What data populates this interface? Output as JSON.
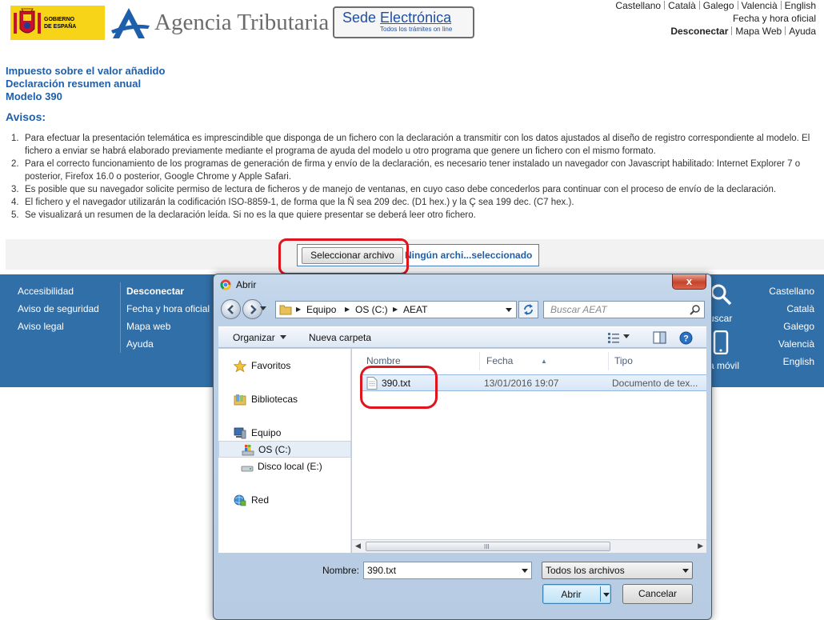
{
  "header": {
    "gov_logo_text": [
      "GOBIERNO",
      "DE ESPAÑA"
    ],
    "agency_name": "Agencia Tributaria",
    "sede_title_a": "Sede ",
    "sede_title_b": "Electrónica",
    "sede_subtitle": "Todos los trámites on line",
    "languages": [
      "Castellano",
      "Català",
      "Galego",
      "Valencià",
      "English"
    ],
    "time_link": "Fecha y hora oficial",
    "logout": "Desconectar",
    "sitemap": "Mapa Web",
    "help": "Ayuda"
  },
  "page": {
    "title_lines": [
      "Impuesto sobre el valor añadido",
      "Declaración resumen anual",
      "Modelo 390"
    ],
    "avisos_heading": "Avisos:",
    "notices": [
      "Para efectuar la presentación telemática es imprescindible que disponga de un fichero con la declaración a transmitir con los datos ajustados al diseño de registro correspondiente al modelo. El fichero a enviar se habrá elaborado previamente mediante el programa de ayuda del modelo u otro programa que genere un fichero con el mismo formato.",
      "Para el correcto funcionamiento de los programas de generación de firma y envío de la declaración, es necesario tener instalado un navegador con Javascript habilitado: Internet Explorer 7 o posterior, Firefox 16.0 o posterior, Google Chrome y Apple Safari.",
      "Es posible que su navegador solicite permiso de lectura de ficheros y de manejo de ventanas, en cuyo caso debe concederlos para continuar con el proceso de envío de la declaración.",
      "El fichero y el navegador utilizarán la codificación ISO-8859-1, de forma que la Ñ sea 209 dec. (D1 hex.) y la Ç sea 199 dec. (C7 hex.).",
      "Se visualizará un resumen de la declaración leída. Si no es la que quiere presentar se deberá leer otro fichero."
    ],
    "notice_numbers": [
      "1.",
      "2.",
      "3.",
      "4.",
      "5."
    ],
    "file_button": "Seleccionar archivo",
    "file_status": "Ningún archi...seleccionado"
  },
  "footer": {
    "col1": [
      "Accesibilidad",
      "Aviso de seguridad",
      "Aviso legal"
    ],
    "col2": [
      "Desconectar",
      "Fecha y hora oficial",
      "Mapa web",
      "Ayuda"
    ],
    "search_partial": "uscar",
    "mobile_partial": "a móvil",
    "languages": [
      "Castellano",
      "Català",
      "Galego",
      "Valencià",
      "English"
    ],
    "bg_color": "#316fa8"
  },
  "dialog": {
    "title": "Abrir",
    "close_glyph": "x",
    "path": [
      "Equipo",
      "OS (C:)",
      "AEAT"
    ],
    "search_placeholder": "Buscar AEAT",
    "organize": "Organizar",
    "new_folder": "Nueva carpeta",
    "nav_items": [
      "Favoritos",
      "Bibliotecas",
      "Equipo",
      "OS (C:)",
      "Disco local (E:)",
      "Red"
    ],
    "columns": [
      "Nombre",
      "Fecha",
      "Tipo"
    ],
    "files": [
      {
        "name": "390.txt",
        "date": "13/01/2016 19:07",
        "type": "Documento de tex..."
      }
    ],
    "filename_label": "Nombre:",
    "filename_value": "390.txt",
    "filetype_value": "Todos los archivos",
    "open_button": "Abrir",
    "cancel_button": "Cancelar",
    "scroll_grip": "III"
  },
  "colors": {
    "accent_blue": "#1e5fab",
    "highlight_red": "#e0141c"
  }
}
